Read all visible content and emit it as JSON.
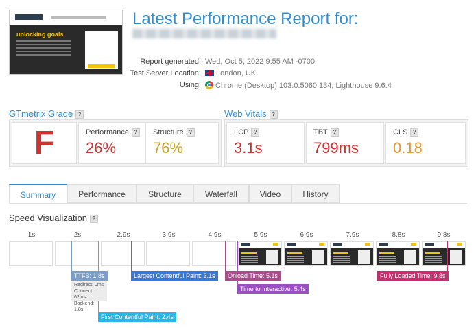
{
  "report": {
    "title": "Latest Performance Report for:",
    "meta": [
      {
        "label": "Report generated:",
        "value": "Wed, Oct 5, 2022 9:55 AM -0700",
        "icon": ""
      },
      {
        "label": "Test Server Location:",
        "value": "London, UK",
        "icon": "uk-flag-icon"
      },
      {
        "label": "Using:",
        "value": "Chrome (Desktop) 103.0.5060.134, Lighthouse 9.6.4",
        "icon": "chrome-icon"
      }
    ],
    "thumbnail": {
      "hero_text": "unlocking goals"
    }
  },
  "grade": {
    "title": "GTmetrix Grade",
    "help": "?",
    "letter": "F",
    "performance": {
      "label": "Performance",
      "value": "26%",
      "color": "#cc3333"
    },
    "structure": {
      "label": "Structure",
      "value": "76%",
      "color": "#c8a02a"
    }
  },
  "vitals": {
    "title": "Web Vitals",
    "help": "?",
    "lcp": {
      "label": "LCP",
      "value": "3.1s",
      "color": "#cc3333"
    },
    "tbt": {
      "label": "TBT",
      "value": "799ms",
      "color": "#cc3333"
    },
    "cls": {
      "label": "CLS",
      "value": "0.18",
      "color": "#e8952c"
    }
  },
  "tabs": [
    "Summary",
    "Performance",
    "Structure",
    "Waterfall",
    "Video",
    "History"
  ],
  "speed": {
    "title": "Speed Visualization",
    "help": "?",
    "ticks": [
      "1s",
      "2s",
      "2.9s",
      "3.9s",
      "4.9s",
      "5.9s",
      "6.9s",
      "7.9s",
      "8.8s",
      "9.8s"
    ],
    "markers": {
      "ttfb": "TTFB: 1.8s",
      "ttfb_redirect": "Redirect: 0ms",
      "ttfb_connect": "Connect: 62ms",
      "ttfb_backend": "Backend: 1.8s",
      "fcp": "First Contentful Paint: 2.4s",
      "lcp": "Largest Contentful Paint: 3.1s",
      "onload": "Onload Time: 5.1s",
      "tti": "Time to Interactive: 5.4s",
      "fully": "Fully Loaded Time: 9.8s"
    },
    "colors": {
      "ttfb": "#7b9ec8",
      "fcp": "#29b6e8",
      "lcp": "#3a78d4",
      "onload": "#a64d8a",
      "tti": "#9b4fc2",
      "fully": "#c2306e"
    }
  }
}
